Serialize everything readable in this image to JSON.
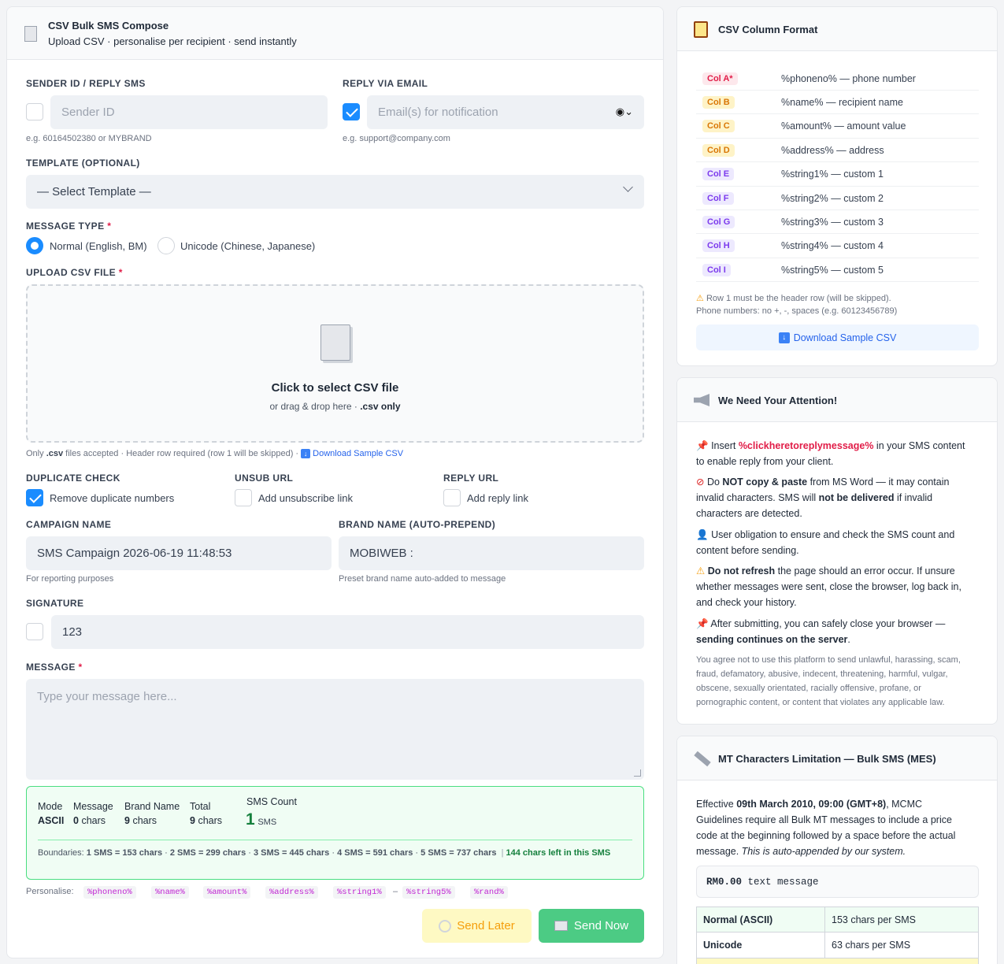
{
  "compose": {
    "title": "CSV Bulk SMS Compose",
    "subtitle": "Upload CSV · personalise per recipient · send instantly",
    "sender": {
      "label": "SENDER ID / REPLY SMS",
      "placeholder": "Sender ID",
      "hint": "e.g. 60164502380 or MYBRAND",
      "checked": false
    },
    "reply_email": {
      "label": "REPLY VIA EMAIL",
      "placeholder": "Email(s) for notification",
      "hint": "e.g. support@company.com",
      "checked": true
    },
    "template": {
      "label": "TEMPLATE (OPTIONAL)",
      "selected": "— Select Template —"
    },
    "message_type": {
      "label": "MESSAGE TYPE",
      "required": "*",
      "options": [
        "Normal (English, BM)",
        "Unicode (Chinese, Japanese)"
      ],
      "selected": 0
    },
    "upload": {
      "label": "UPLOAD CSV FILE",
      "required": "*",
      "title": "Click to select CSV file",
      "sub": "or drag & drop here · ",
      "sub_bold": ".csv only",
      "note_a": "Only ",
      "note_csv": ".csv",
      "note_b": " files accepted · Header row required (row 1 will be skipped) · ",
      "note_link": "Download Sample CSV"
    },
    "duplicate": {
      "label": "DUPLICATE CHECK",
      "option": "Remove duplicate numbers",
      "checked": true
    },
    "unsub": {
      "label": "UNSUB URL",
      "option": "Add unsubscribe link",
      "checked": false
    },
    "reply_url": {
      "label": "REPLY URL",
      "option": "Add reply link",
      "checked": false
    },
    "campaign": {
      "label": "CAMPAIGN NAME",
      "value": "SMS Campaign 2026-06-19 11:48:53",
      "hint": "For reporting purposes"
    },
    "brand": {
      "label": "BRAND NAME (AUTO-PREPEND)",
      "value": "MOBIWEB :",
      "hint": "Preset brand name auto-added to message"
    },
    "signature": {
      "label": "SIGNATURE",
      "value": "123",
      "checked": false
    },
    "message": {
      "label": "MESSAGE",
      "required": "*",
      "placeholder": "Type your message here..."
    },
    "stats": {
      "mode_label": "Mode",
      "mode_value": "ASCII",
      "message_label": "Message",
      "message_value": "0",
      "message_unit": "chars",
      "brand_label": "Brand Name",
      "brand_value": "9",
      "brand_unit": "chars",
      "total_label": "Total",
      "total_value": "9",
      "total_unit": "chars",
      "sms_label": "SMS Count",
      "sms_value": "1",
      "sms_unit": "SMS",
      "boundaries_label": "Boundaries:",
      "boundaries": [
        "1 SMS = 153 chars",
        "2 SMS = 299 chars",
        "3 SMS = 445 chars",
        "4 SMS = 591 chars",
        "5 SMS = 737 chars"
      ],
      "left": "144 chars left in this SMS"
    },
    "personalise": {
      "label": "Personalise:",
      "tokens": [
        "%phoneno%",
        "%name%",
        "%amount%",
        "%address%",
        "%string1%",
        "–",
        "%string5%",
        "%rand%"
      ]
    },
    "send_later": "Send Later",
    "send_now": "Send Now"
  },
  "columns": {
    "title": "CSV Column Format",
    "rows": [
      {
        "col": "Col A*",
        "desc": "%phoneno% — phone number",
        "color": "red"
      },
      {
        "col": "Col B",
        "desc": "%name% — recipient name",
        "color": "yellow"
      },
      {
        "col": "Col C",
        "desc": "%amount% — amount value",
        "color": "yellow"
      },
      {
        "col": "Col D",
        "desc": "%address% — address",
        "color": "yellow"
      },
      {
        "col": "Col E",
        "desc": "%string1% — custom 1",
        "color": "purple"
      },
      {
        "col": "Col F",
        "desc": "%string2% — custom 2",
        "color": "purple"
      },
      {
        "col": "Col G",
        "desc": "%string3% — custom 3",
        "color": "purple"
      },
      {
        "col": "Col H",
        "desc": "%string4% — custom 4",
        "color": "purple"
      },
      {
        "col": "Col I",
        "desc": "%string5% — custom 5",
        "color": "purple"
      }
    ],
    "note1": "Row 1 must be the header row (will be skipped).",
    "note2": "Phone numbers: no +, -, spaces (e.g. 60123456789)",
    "download": "Download Sample CSV"
  },
  "attention": {
    "title": "We Need Your Attention!",
    "p1_a": "Insert ",
    "p1_b": "%clickheretoreplymessage%",
    "p1_c": " in your SMS content",
    "p1_d": "to enable reply from your client.",
    "p2_a": "Do ",
    "p2_b": "NOT copy & paste",
    "p2_c": " from MS Word — it may contain",
    "p2_d": "invalid characters. SMS will ",
    "p2_e": "not be delivered",
    "p2_f": " if invalid",
    "p2_g": "characters are detected.",
    "p3_a": "User obligation to ensure and check the SMS count and",
    "p3_b": "content before sending.",
    "p4_a": "Do not refresh",
    "p4_b": " the page should an error occur. If unsure",
    "p4_c": "whether messages were sent, close the browser, log back in,",
    "p4_d": "and check your history.",
    "p5_a": "After submitting, you can safely close your browser —",
    "p5_b": "sending continues on the server",
    "p5_c": ".",
    "legal": [
      "You agree not to use this platform to send unlawful, harassing, scam,",
      "fraud, defamatory, abusive, indecent, threatening, harmful, vulgar,",
      "obscene, sexually orientated, racially offensive, profane, or",
      "pornographic content, or content that violates any applicable law."
    ]
  },
  "limits": {
    "title": "MT Characters Limitation — Bulk SMS (MES)",
    "p_a": "Effective ",
    "p_b": "09th March 2010, 09:00 (GMT+8)",
    "p_c": ", MCMC",
    "p_d": "Guidelines require all Bulk MT messages to include a price",
    "p_e": "code at the beginning followed by a space before the actual",
    "p_f": "message. ",
    "p_g": "This is auto-appended by our system.",
    "code_bold": "RM0.00",
    "code_rest": " text message",
    "rows": [
      {
        "type": "Normal (ASCII)",
        "limit": "153 chars per SMS"
      },
      {
        "type": "Unicode",
        "limit": "63 chars per SMS"
      }
    ]
  }
}
